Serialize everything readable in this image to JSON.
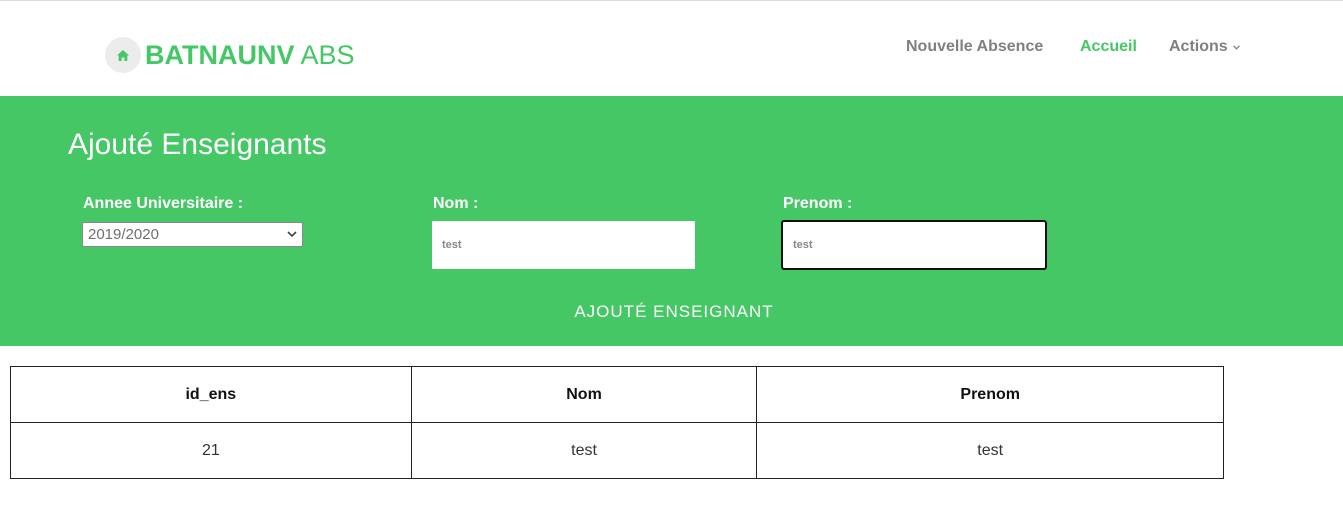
{
  "header": {
    "brand_bold": "BATNAUNV",
    "brand_light": "ABS",
    "nav": {
      "new_absence": "Nouvelle Absence",
      "home": "Accueil",
      "actions": "Actions"
    }
  },
  "form": {
    "title": "Ajouté Enseignants",
    "annee_label": "Annee Universitaire :",
    "annee_value": "2019/2020",
    "nom_label": "Nom :",
    "nom_value": "test",
    "prenom_label": "Prenom :",
    "prenom_value": "test",
    "submit_label": "AJOUTÉ ENSEIGNANT"
  },
  "table": {
    "columns": [
      "id_ens",
      "Nom",
      "Prenom"
    ],
    "rows": [
      [
        "21",
        "test",
        "test"
      ]
    ]
  },
  "colors": {
    "accent": "#45c765",
    "nav_text": "#808080",
    "white": "#ffffff"
  },
  "icons": {
    "home": "home-icon",
    "actions_dropdown": "chevron-down-icon",
    "select_dropdown": "chevron-down-icon"
  }
}
